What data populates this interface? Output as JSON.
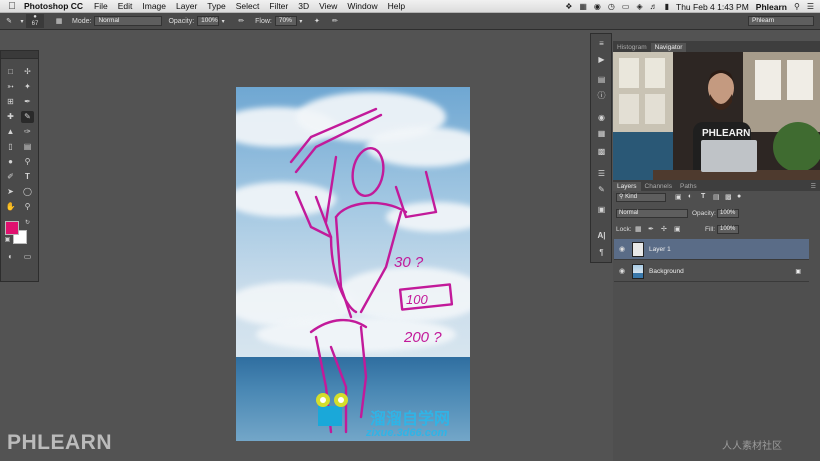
{
  "menubar": {
    "app_name": "Photoshop CC",
    "items": [
      "File",
      "Edit",
      "Image",
      "Layer",
      "Type",
      "Select",
      "Filter",
      "3D",
      "View",
      "Window",
      "Help"
    ],
    "clock": "Thu Feb 4  1:43 PM",
    "user": "Phlearn"
  },
  "options": {
    "brush_size": "67",
    "mode_label": "Mode:",
    "mode_value": "Normal",
    "opacity_label": "Opacity:",
    "opacity_value": "100%",
    "flow_label": "Flow:",
    "flow_value": "70%",
    "workspace": "Phlearn"
  },
  "colors": {
    "foreground": "#e0116f",
    "background": "#ffffff",
    "sketch": "#c21a9a"
  },
  "canvas": {
    "notes": [
      "30 ?",
      "100",
      "200 ?"
    ]
  },
  "panels": {
    "top_tabs": [
      "Histogram",
      "Navigator"
    ],
    "video_text": "PHLEARN",
    "layer_tabs": [
      "Layers",
      "Channels",
      "Paths"
    ],
    "filter_kind": "Kind",
    "blend_mode": "Normal",
    "opacity_label": "Opacity:",
    "opacity_value": "100%",
    "lock_label": "Lock:",
    "fill_label": "Fill:",
    "fill_value": "100%",
    "layers": [
      {
        "name": "Layer 1"
      },
      {
        "name": "Background"
      }
    ]
  },
  "watermarks": {
    "brand": "PHLEARN",
    "site_cn": "溜溜自学网",
    "site_url": "zixue.3d66.com",
    "corner_cn": "人人素材社区"
  },
  "icons": {
    "apple": "apple-icon",
    "brush": "brush-icon",
    "eye": "eye-icon",
    "lock": "lock-icon"
  }
}
